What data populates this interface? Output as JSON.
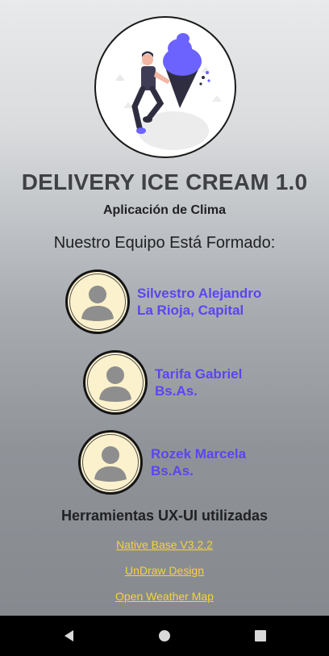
{
  "app": {
    "title": "DELIVERY ICE CREAM 1.0",
    "subtitle": "Aplicación de Clima"
  },
  "hero_illustration": {
    "icon": "ice-cream-person-illustration",
    "accent_color": "#6c63ff"
  },
  "team": {
    "heading": "Nuestro Equipo Está Formado:",
    "members": [
      {
        "name": "Silvestro Alejandro",
        "location": "La Rioja, Capital",
        "avatar_icon": "user-avatar-icon"
      },
      {
        "name": "Tarifa Gabriel",
        "location": "Bs.As.",
        "avatar_icon": "user-avatar-icon"
      },
      {
        "name": "Rozek Marcela",
        "location": "Bs.As.",
        "avatar_icon": "user-avatar-icon"
      }
    ],
    "name_color": "#5b45f0"
  },
  "tools": {
    "heading": "Herramientas UX-UI utilizadas",
    "links": [
      {
        "label": "Native Base V3.2.2"
      },
      {
        "label": "UnDraw Design"
      },
      {
        "label": "Open Weather Map"
      }
    ],
    "link_color": "#f5d33a"
  },
  "navbar": {
    "buttons": [
      "back-icon",
      "home-icon",
      "recents-icon"
    ]
  }
}
